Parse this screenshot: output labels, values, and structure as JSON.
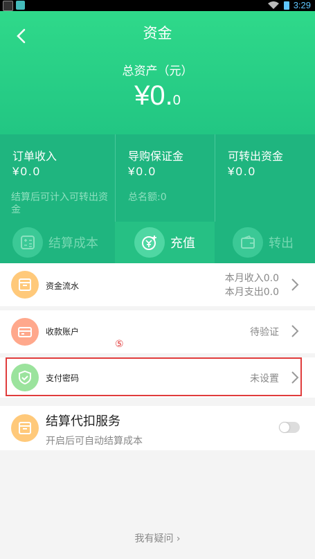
{
  "status_bar": {
    "time": "3:29"
  },
  "header": {
    "title": "资金",
    "total_label": "总资产（元）",
    "total_int": "¥0.",
    "total_dec": "0"
  },
  "stats": [
    {
      "name": "订单收入",
      "value": "¥0.0",
      "note": "结算后可计入可转出资金"
    },
    {
      "name": "导购保证金",
      "value": "¥0.0",
      "note": "总名额:0"
    },
    {
      "name": "可转出资金",
      "value": "¥0.0",
      "note": ""
    }
  ],
  "actions": {
    "settle": "结算成本",
    "recharge": "充值",
    "transfer": "转出"
  },
  "rows": {
    "flow": {
      "label": "资金流水",
      "income": "本月收入0.0",
      "expense": "本月支出0.0"
    },
    "account": {
      "label": "收款账户",
      "status": "待验证"
    },
    "password": {
      "label": "支付密码",
      "status": "未设置"
    },
    "service": {
      "title": "结算代扣服务",
      "subtitle": "开启后可自动结算成本",
      "enabled": false
    }
  },
  "annotation": "⑤",
  "colors": {
    "brand_green": "#22c683",
    "highlight_red": "#e03c3c"
  },
  "help": {
    "text": "我有疑问 ›"
  }
}
